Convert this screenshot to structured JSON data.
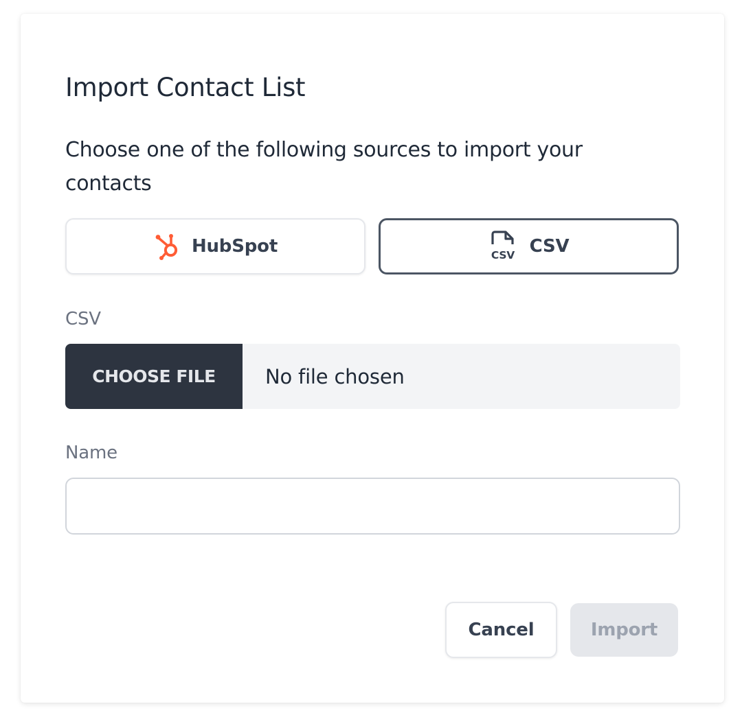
{
  "dialog": {
    "title": "Import Contact List",
    "subtitle": "Choose one of the following sources to import your contacts"
  },
  "sources": {
    "hubspot": {
      "label": "HubSpot",
      "icon": "hubspot-icon",
      "color": "#ff5c35",
      "selected": false
    },
    "csv": {
      "label": "CSV",
      "icon": "csv-file-icon",
      "selected": true
    }
  },
  "csv_field": {
    "label": "CSV",
    "choose_button_label": "CHOOSE FILE",
    "status": "No file chosen"
  },
  "name_field": {
    "label": "Name",
    "value": ""
  },
  "actions": {
    "cancel_label": "Cancel",
    "import_label": "Import",
    "import_disabled": true
  },
  "colors": {
    "selected_border": "#4b5563",
    "choose_file_bg": "#2d3440",
    "disabled_bg": "#e5e7eb"
  }
}
